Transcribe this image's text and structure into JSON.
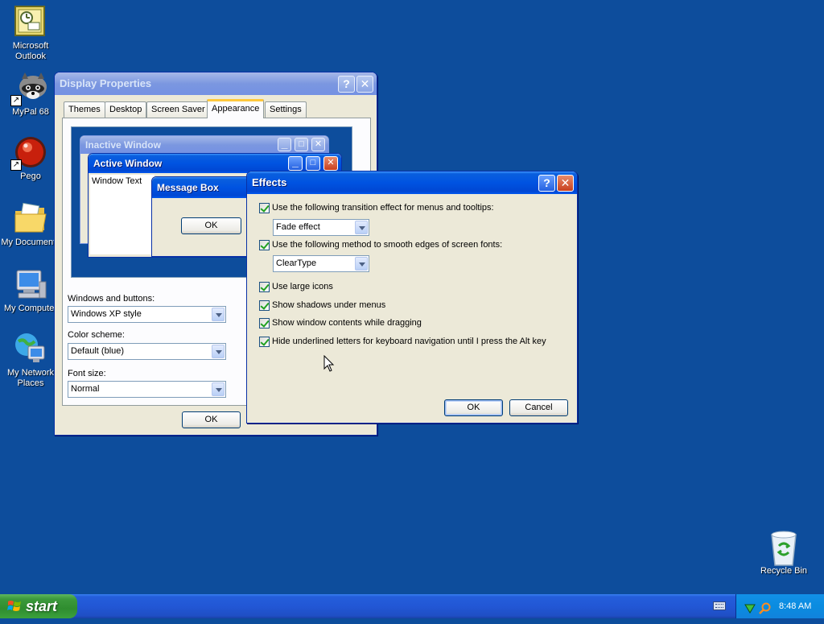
{
  "desktop": {
    "icons": [
      {
        "label": "Microsoft Outlook",
        "icon": "outlook-icon"
      },
      {
        "label": "MyPal 68",
        "icon": "raccoon-icon"
      },
      {
        "label": "Pego",
        "icon": "red-ball-icon"
      },
      {
        "label": "My Documents",
        "icon": "folder-icon"
      },
      {
        "label": "My Computer",
        "icon": "computer-icon"
      },
      {
        "label": "My Network Places",
        "icon": "network-icon"
      },
      {
        "label": "Recycle Bin",
        "icon": "recycle-bin-icon"
      }
    ],
    "shortcut_glyph": "↗"
  },
  "display_properties": {
    "title": "Display Properties",
    "help_glyph": "?",
    "close_glyph": "✕",
    "tabs": [
      "Themes",
      "Desktop",
      "Screen Saver",
      "Appearance",
      "Settings"
    ],
    "selected_tab": "Appearance",
    "preview": {
      "inactive_title": "Inactive Window",
      "active_title": "Active Window",
      "window_text": "Window Text",
      "message_box_title": "Message Box",
      "message_ok": "OK"
    },
    "windows_buttons_label": "Windows and buttons:",
    "windows_buttons_value": "Windows XP style",
    "color_scheme_label": "Color scheme:",
    "color_scheme_value": "Default (blue)",
    "font_size_label": "Font size:",
    "font_size_value": "Normal",
    "ok_label": "OK"
  },
  "effects": {
    "title": "Effects",
    "help_glyph": "?",
    "close_glyph": "✕",
    "options": [
      {
        "label": "Use the following transition effect for menus and tooltips:",
        "checked": true
      },
      {
        "label": "Use the following method to smooth edges of screen fonts:",
        "checked": true
      },
      {
        "label": "Use large icons",
        "checked": true
      },
      {
        "label": "Show shadows under menus",
        "checked": true
      },
      {
        "label": "Show window contents while dragging",
        "checked": true
      },
      {
        "label": "Hide underlined letters for keyboard navigation until I press the Alt key",
        "checked": true
      }
    ],
    "transition_value": "Fade effect",
    "smoothing_value": "ClearType",
    "ok_label": "OK",
    "cancel_label": "Cancel"
  },
  "taskbar": {
    "start_label": "start",
    "clock": "8:48 AM"
  },
  "colors": {
    "desktop": "#0d4d9c",
    "title_active": "#0053e1",
    "window_face": "#ece9d8",
    "start_green": "#3c9a3c"
  }
}
